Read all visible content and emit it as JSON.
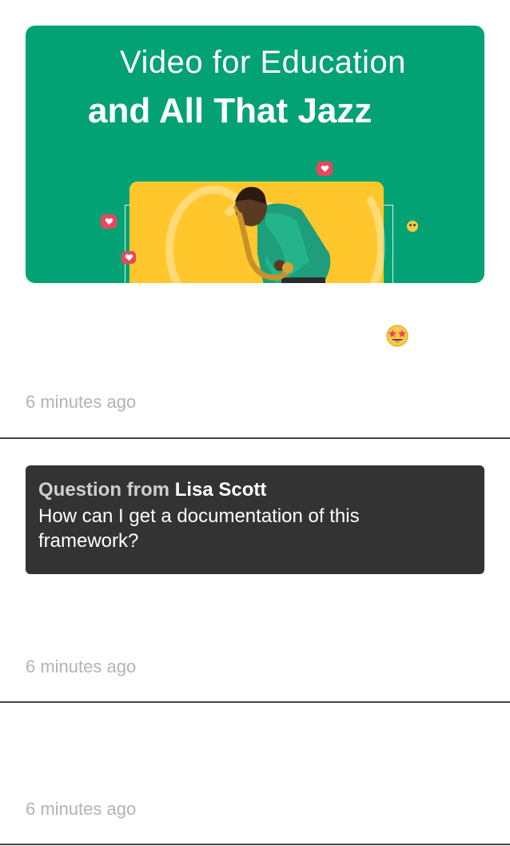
{
  "feed": {
    "posts": [
      {
        "banner": {
          "title_line1": "Video for Education",
          "title_line2": "and All That Jazz",
          "background_color": "#02a275",
          "card_color": "#ffc72c"
        },
        "reaction_icon": "star-struck-emoji-icon",
        "timestamp": "6 minutes ago"
      },
      {
        "question": {
          "prefix": "Question from",
          "author": "Lisa Scott",
          "body": "How can I get a documentation of this framework?"
        },
        "timestamp": "6 minutes ago"
      },
      {
        "timestamp": "6 minutes ago"
      }
    ]
  },
  "colors": {
    "timestamp": "#b3b3b3",
    "question_card_bg": "#333333",
    "divider": "#444444"
  }
}
